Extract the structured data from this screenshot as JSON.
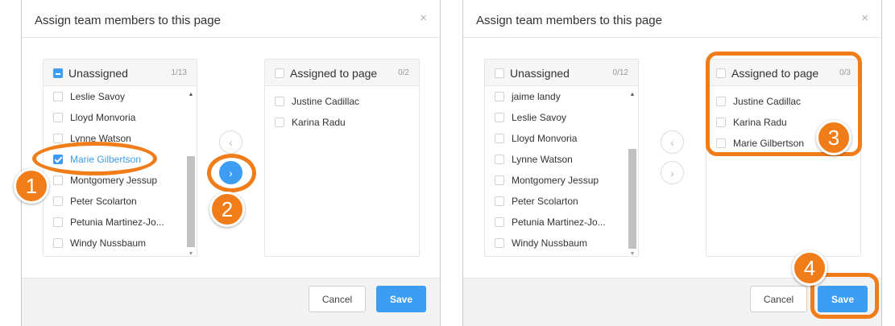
{
  "colors": {
    "accent": "#3d9df2",
    "callout": "#f07d1a"
  },
  "icons": {
    "close": "close-icon",
    "left": "chevron-left-icon",
    "right": "chevron-right-icon",
    "scroll_up": "scroll-up-icon",
    "scroll_down": "scroll-down-icon"
  },
  "step1": {
    "title": "Assign team members to this page",
    "close": "×",
    "unassigned": {
      "title": "Unassigned",
      "count": "1/13",
      "items": [
        {
          "label": "Leslie Savoy"
        },
        {
          "label": "Lloyd Monvoria"
        },
        {
          "label": "Lynne Watson"
        },
        {
          "label": "Marie Gilbertson"
        },
        {
          "label": "Montgomery Jessup"
        },
        {
          "label": "Peter Scolarton"
        },
        {
          "label": "Petunia Martinez-Jo..."
        },
        {
          "label": "Windy Nussbaum"
        }
      ]
    },
    "assigned": {
      "title": "Assigned to page",
      "count": "0/2",
      "items": [
        {
          "label": "Justine Cadillac"
        },
        {
          "label": "Karina Radu"
        }
      ]
    },
    "move_left": "‹",
    "move_right": "›",
    "cancel": "Cancel",
    "save": "Save"
  },
  "step2": {
    "title": "Assign team members to this page",
    "close": "×",
    "unassigned": {
      "title": "Unassigned",
      "count": "0/12",
      "items": [
        {
          "label": "jaime landy"
        },
        {
          "label": "Leslie Savoy"
        },
        {
          "label": "Lloyd Monvoria"
        },
        {
          "label": "Lynne Watson"
        },
        {
          "label": "Montgomery Jessup"
        },
        {
          "label": "Peter Scolarton"
        },
        {
          "label": "Petunia Martinez-Jo..."
        },
        {
          "label": "Windy Nussbaum"
        }
      ]
    },
    "assigned": {
      "title": "Assigned to page",
      "count": "0/3",
      "items": [
        {
          "label": "Justine Cadillac"
        },
        {
          "label": "Karina Radu"
        },
        {
          "label": "Marie Gilbertson"
        }
      ]
    },
    "move_left": "‹",
    "move_right": "›",
    "cancel": "Cancel",
    "save": "Save"
  },
  "callouts": {
    "one": "1",
    "two": "2",
    "three": "3",
    "four": "4"
  }
}
